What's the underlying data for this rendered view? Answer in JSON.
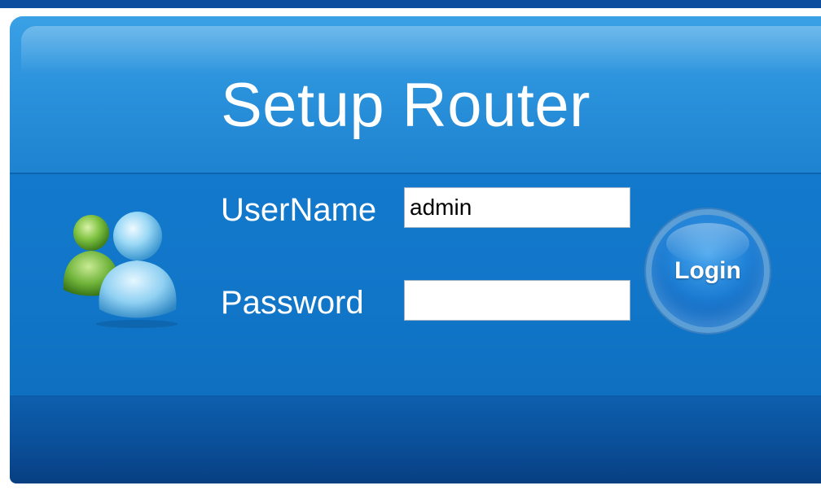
{
  "header": {
    "title": "Setup Router"
  },
  "form": {
    "username_label": "UserName",
    "username_value": "admin",
    "password_label": "Password",
    "password_value": ""
  },
  "login": {
    "label": "Login"
  },
  "icons": {
    "users": "users-icon"
  },
  "colors": {
    "panel_blue": "#1178c9",
    "header_blue": "#2b92dc",
    "footer_blue": "#0a4f99",
    "top_strip": "#0d4f9e",
    "user_green": "#6fb33a",
    "user_light_blue": "#8fd0f2"
  }
}
